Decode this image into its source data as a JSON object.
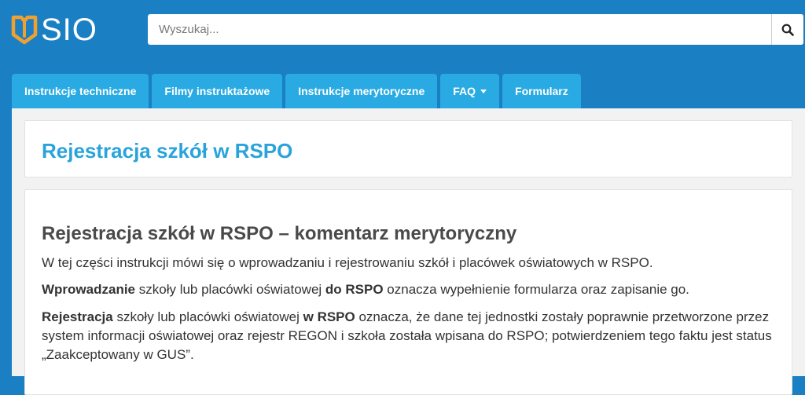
{
  "brand": {
    "logo_text": "SIO"
  },
  "search": {
    "placeholder": "Wyszukaj..."
  },
  "nav": {
    "tabs": [
      {
        "label": "Instrukcje techniczne"
      },
      {
        "label": "Filmy instruktażowe"
      },
      {
        "label": "Instrukcje merytoryczne"
      },
      {
        "label": "FAQ",
        "has_dropdown": true
      },
      {
        "label": "Formularz"
      }
    ]
  },
  "page": {
    "title": "Rejestracja szkół w RSPO",
    "section_heading": "Rejestracja szkół w RSPO – komentarz merytoryczny",
    "p1": "W tej części instrukcji mówi się o wprowadzaniu i rejestrowaniu szkół i placówek oświatowych w RSPO.",
    "p2": {
      "b1": "Wprowadzanie",
      "t1": " szkoły lub placówki oświatowej ",
      "b2": "do RSPO",
      "t2": " oznacza wypełnienie formularza oraz zapisanie go."
    },
    "p3": {
      "b1": "Rejestracja",
      "t1": " szkoły lub placówki oświatowej ",
      "b2": "w RSPO",
      "t2": " oznacza, że dane tej jednostki zostały poprawnie przetworzone przez system informacji oświatowej oraz rejestr REGON i szkoła została wpisana do RSPO; potwierdzeniem tego faktu jest status „Zaakceptowany w GUS”."
    }
  },
  "colors": {
    "header_bg": "#1b7fc4",
    "tab_bg": "#29aae2",
    "title_color": "#29a3dc",
    "logo_accent": "#f0a030"
  },
  "icons": {
    "logo": "book-logo-icon",
    "search": "search-icon",
    "dropdown": "caret-down-icon"
  }
}
